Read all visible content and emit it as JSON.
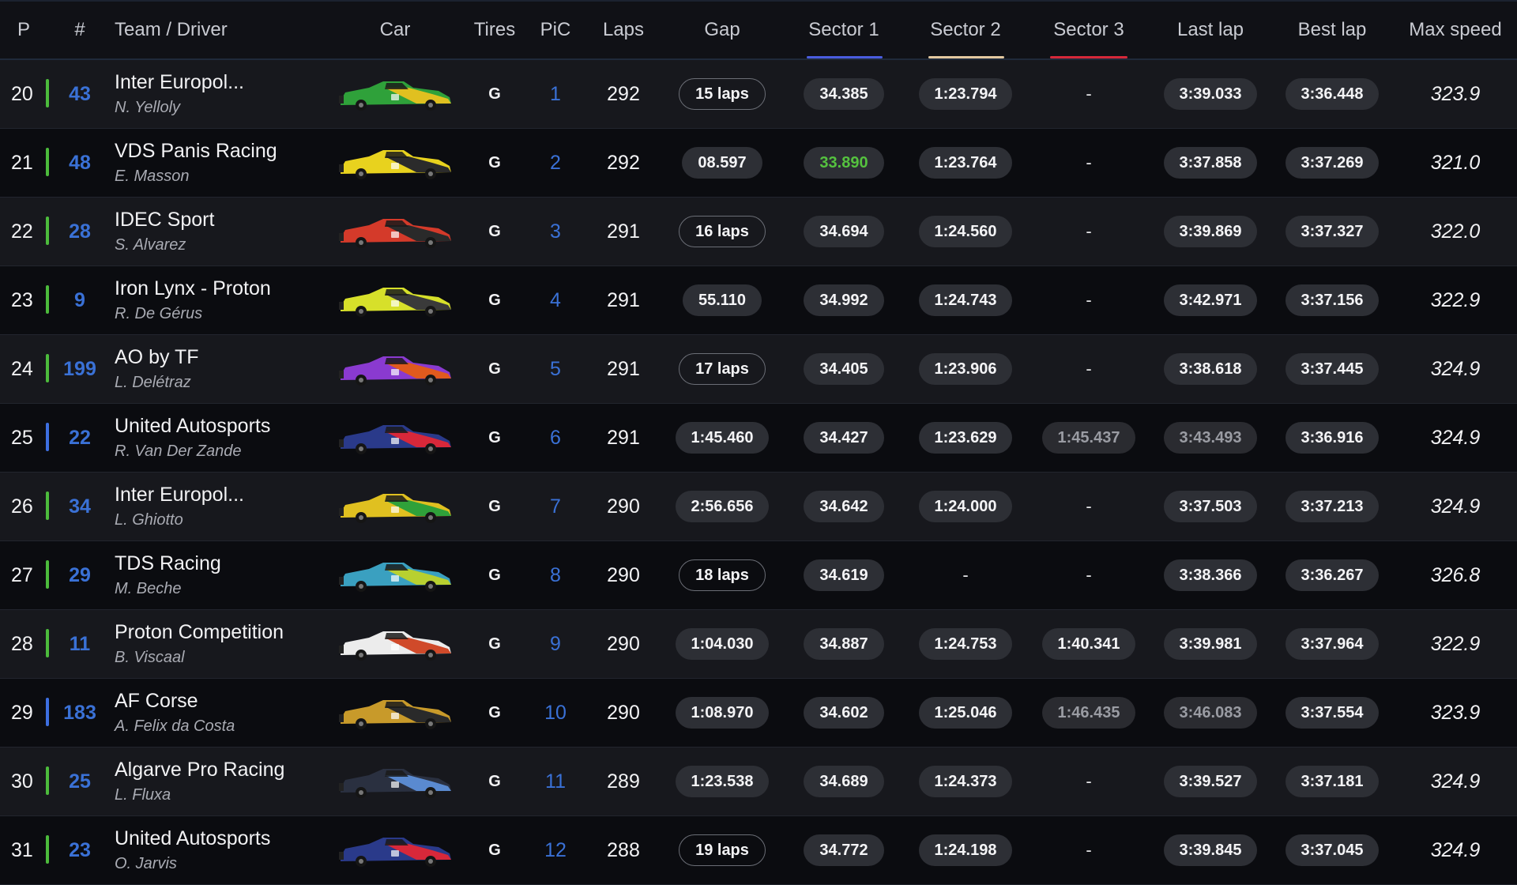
{
  "header": {
    "p": "P",
    "num": "#",
    "team_driver": "Team / Driver",
    "car": "Car",
    "tires": "Tires",
    "pic": "PiC",
    "laps": "Laps",
    "gap": "Gap",
    "sector1": "Sector 1",
    "sector2": "Sector 2",
    "sector3": "Sector 3",
    "last_lap": "Last lap",
    "best_lap": "Best lap",
    "max_speed": "Max speed"
  },
  "colors": {
    "sector1": "#4a5de0",
    "sector2": "#e3c8a0",
    "sector3": "#d6283a",
    "bar_green": "#4cbb3c",
    "bar_blue": "#3d6fe0",
    "accent_blue": "#3a71d6"
  },
  "rows": [
    {
      "p": "20",
      "bar": "green",
      "num": "43",
      "team": "Inter Europol...",
      "driver": "N. Yelloly",
      "car": {
        "c1": "#2fa13a",
        "c2": "#e0c020"
      },
      "tires": "G",
      "pic": "1",
      "laps": "292",
      "gap": "15 laps",
      "gap_style": "outline",
      "s1": "34.385",
      "s1_style": "",
      "s2": "1:23.794",
      "s2_style": "",
      "s3": "-",
      "s3_style": "dash",
      "last": "3:39.033",
      "last_style": "",
      "best": "3:36.448",
      "speed": "323.9"
    },
    {
      "p": "21",
      "bar": "green",
      "num": "48",
      "team": "VDS Panis Racing",
      "driver": "E. Masson",
      "car": {
        "c1": "#e8d21e",
        "c2": "#2b2b2b"
      },
      "tires": "G",
      "pic": "2",
      "laps": "292",
      "gap": "08.597",
      "gap_style": "",
      "s1": "33.890",
      "s1_style": "green",
      "s2": "1:23.764",
      "s2_style": "",
      "s3": "-",
      "s3_style": "dash",
      "last": "3:37.858",
      "last_style": "",
      "best": "3:37.269",
      "speed": "321.0"
    },
    {
      "p": "22",
      "bar": "green",
      "num": "28",
      "team": "IDEC Sport",
      "driver": "S. Alvarez",
      "car": {
        "c1": "#d43a2a",
        "c2": "#2a2a2a"
      },
      "tires": "G",
      "pic": "3",
      "laps": "291",
      "gap": "16 laps",
      "gap_style": "outline",
      "s1": "34.694",
      "s1_style": "",
      "s2": "1:24.560",
      "s2_style": "",
      "s3": "-",
      "s3_style": "dash",
      "last": "3:39.869",
      "last_style": "",
      "best": "3:37.327",
      "speed": "322.0"
    },
    {
      "p": "23",
      "bar": "green",
      "num": "9",
      "team": "Iron Lynx - Proton",
      "driver": "R. De Gérus",
      "car": {
        "c1": "#d7e02a",
        "c2": "#3a3a3a"
      },
      "tires": "G",
      "pic": "4",
      "laps": "291",
      "gap": "55.110",
      "gap_style": "",
      "s1": "34.992",
      "s1_style": "",
      "s2": "1:24.743",
      "s2_style": "",
      "s3": "-",
      "s3_style": "dash",
      "last": "3:42.971",
      "last_style": "",
      "best": "3:37.156",
      "speed": "322.9"
    },
    {
      "p": "24",
      "bar": "green",
      "num": "199",
      "team": "AO by TF",
      "driver": "L. Delétraz",
      "car": {
        "c1": "#8a3ad0",
        "c2": "#e05a1e"
      },
      "tires": "G",
      "pic": "5",
      "laps": "291",
      "gap": "17 laps",
      "gap_style": "outline",
      "s1": "34.405",
      "s1_style": "",
      "s2": "1:23.906",
      "s2_style": "",
      "s3": "-",
      "s3_style": "dash",
      "last": "3:38.618",
      "last_style": "",
      "best": "3:37.445",
      "speed": "324.9"
    },
    {
      "p": "25",
      "bar": "blue",
      "num": "22",
      "team": "United Autosports",
      "driver": "R. Van Der Zande",
      "car": {
        "c1": "#2a3a8a",
        "c2": "#d8283a"
      },
      "tires": "G",
      "pic": "6",
      "laps": "291",
      "gap": "1:45.460",
      "gap_style": "",
      "s1": "34.427",
      "s1_style": "",
      "s2": "1:23.629",
      "s2_style": "",
      "s3": "1:45.437",
      "s3_style": "grey",
      "last": "3:43.493",
      "last_style": "grey",
      "best": "3:36.916",
      "speed": "324.9"
    },
    {
      "p": "26",
      "bar": "green",
      "num": "34",
      "team": "Inter Europol...",
      "driver": "L. Ghiotto",
      "car": {
        "c1": "#e0c020",
        "c2": "#2fa13a"
      },
      "tires": "G",
      "pic": "7",
      "laps": "290",
      "gap": "2:56.656",
      "gap_style": "",
      "s1": "34.642",
      "s1_style": "",
      "s2": "1:24.000",
      "s2_style": "",
      "s3": "-",
      "s3_style": "dash",
      "last": "3:37.503",
      "last_style": "",
      "best": "3:37.213",
      "speed": "324.9"
    },
    {
      "p": "27",
      "bar": "green",
      "num": "29",
      "team": "TDS Racing",
      "driver": "M. Beche",
      "car": {
        "c1": "#3aa0c0",
        "c2": "#b8d030"
      },
      "tires": "G",
      "pic": "8",
      "laps": "290",
      "gap": "18 laps",
      "gap_style": "outline",
      "s1": "34.619",
      "s1_style": "",
      "s2": "-",
      "s2_style": "dash",
      "s3": "-",
      "s3_style": "dash",
      "last": "3:38.366",
      "last_style": "",
      "best": "3:36.267",
      "speed": "326.8"
    },
    {
      "p": "28",
      "bar": "green",
      "num": "11",
      "team": "Proton Competition",
      "driver": "B. Viscaal",
      "car": {
        "c1": "#ececec",
        "c2": "#d04a2a"
      },
      "tires": "G",
      "pic": "9",
      "laps": "290",
      "gap": "1:04.030",
      "gap_style": "",
      "s1": "34.887",
      "s1_style": "",
      "s2": "1:24.753",
      "s2_style": "",
      "s3": "1:40.341",
      "s3_style": "",
      "last": "3:39.981",
      "last_style": "",
      "best": "3:37.964",
      "speed": "322.9"
    },
    {
      "p": "29",
      "bar": "blue",
      "num": "183",
      "team": "AF Corse",
      "driver": "A. Felix da Costa",
      "car": {
        "c1": "#c89a2a",
        "c2": "#2a2a2a"
      },
      "tires": "G",
      "pic": "10",
      "laps": "290",
      "gap": "1:08.970",
      "gap_style": "",
      "s1": "34.602",
      "s1_style": "",
      "s2": "1:25.046",
      "s2_style": "",
      "s3": "1:46.435",
      "s3_style": "grey",
      "last": "3:46.083",
      "last_style": "grey",
      "best": "3:37.554",
      "speed": "323.9"
    },
    {
      "p": "30",
      "bar": "green",
      "num": "25",
      "team": "Algarve Pro Racing",
      "driver": "L. Fluxa",
      "car": {
        "c1": "#2a3040",
        "c2": "#5a8ad0"
      },
      "tires": "G",
      "pic": "11",
      "laps": "289",
      "gap": "1:23.538",
      "gap_style": "",
      "s1": "34.689",
      "s1_style": "",
      "s2": "1:24.373",
      "s2_style": "",
      "s3": "-",
      "s3_style": "dash",
      "last": "3:39.527",
      "last_style": "",
      "best": "3:37.181",
      "speed": "324.9"
    },
    {
      "p": "31",
      "bar": "green",
      "num": "23",
      "team": "United Autosports",
      "driver": "O. Jarvis",
      "car": {
        "c1": "#2a3a8a",
        "c2": "#d8283a"
      },
      "tires": "G",
      "pic": "12",
      "laps": "288",
      "gap": "19 laps",
      "gap_style": "outline",
      "s1": "34.772",
      "s1_style": "",
      "s2": "1:24.198",
      "s2_style": "",
      "s3": "-",
      "s3_style": "dash",
      "last": "3:39.845",
      "last_style": "",
      "best": "3:37.045",
      "speed": "324.9"
    }
  ]
}
